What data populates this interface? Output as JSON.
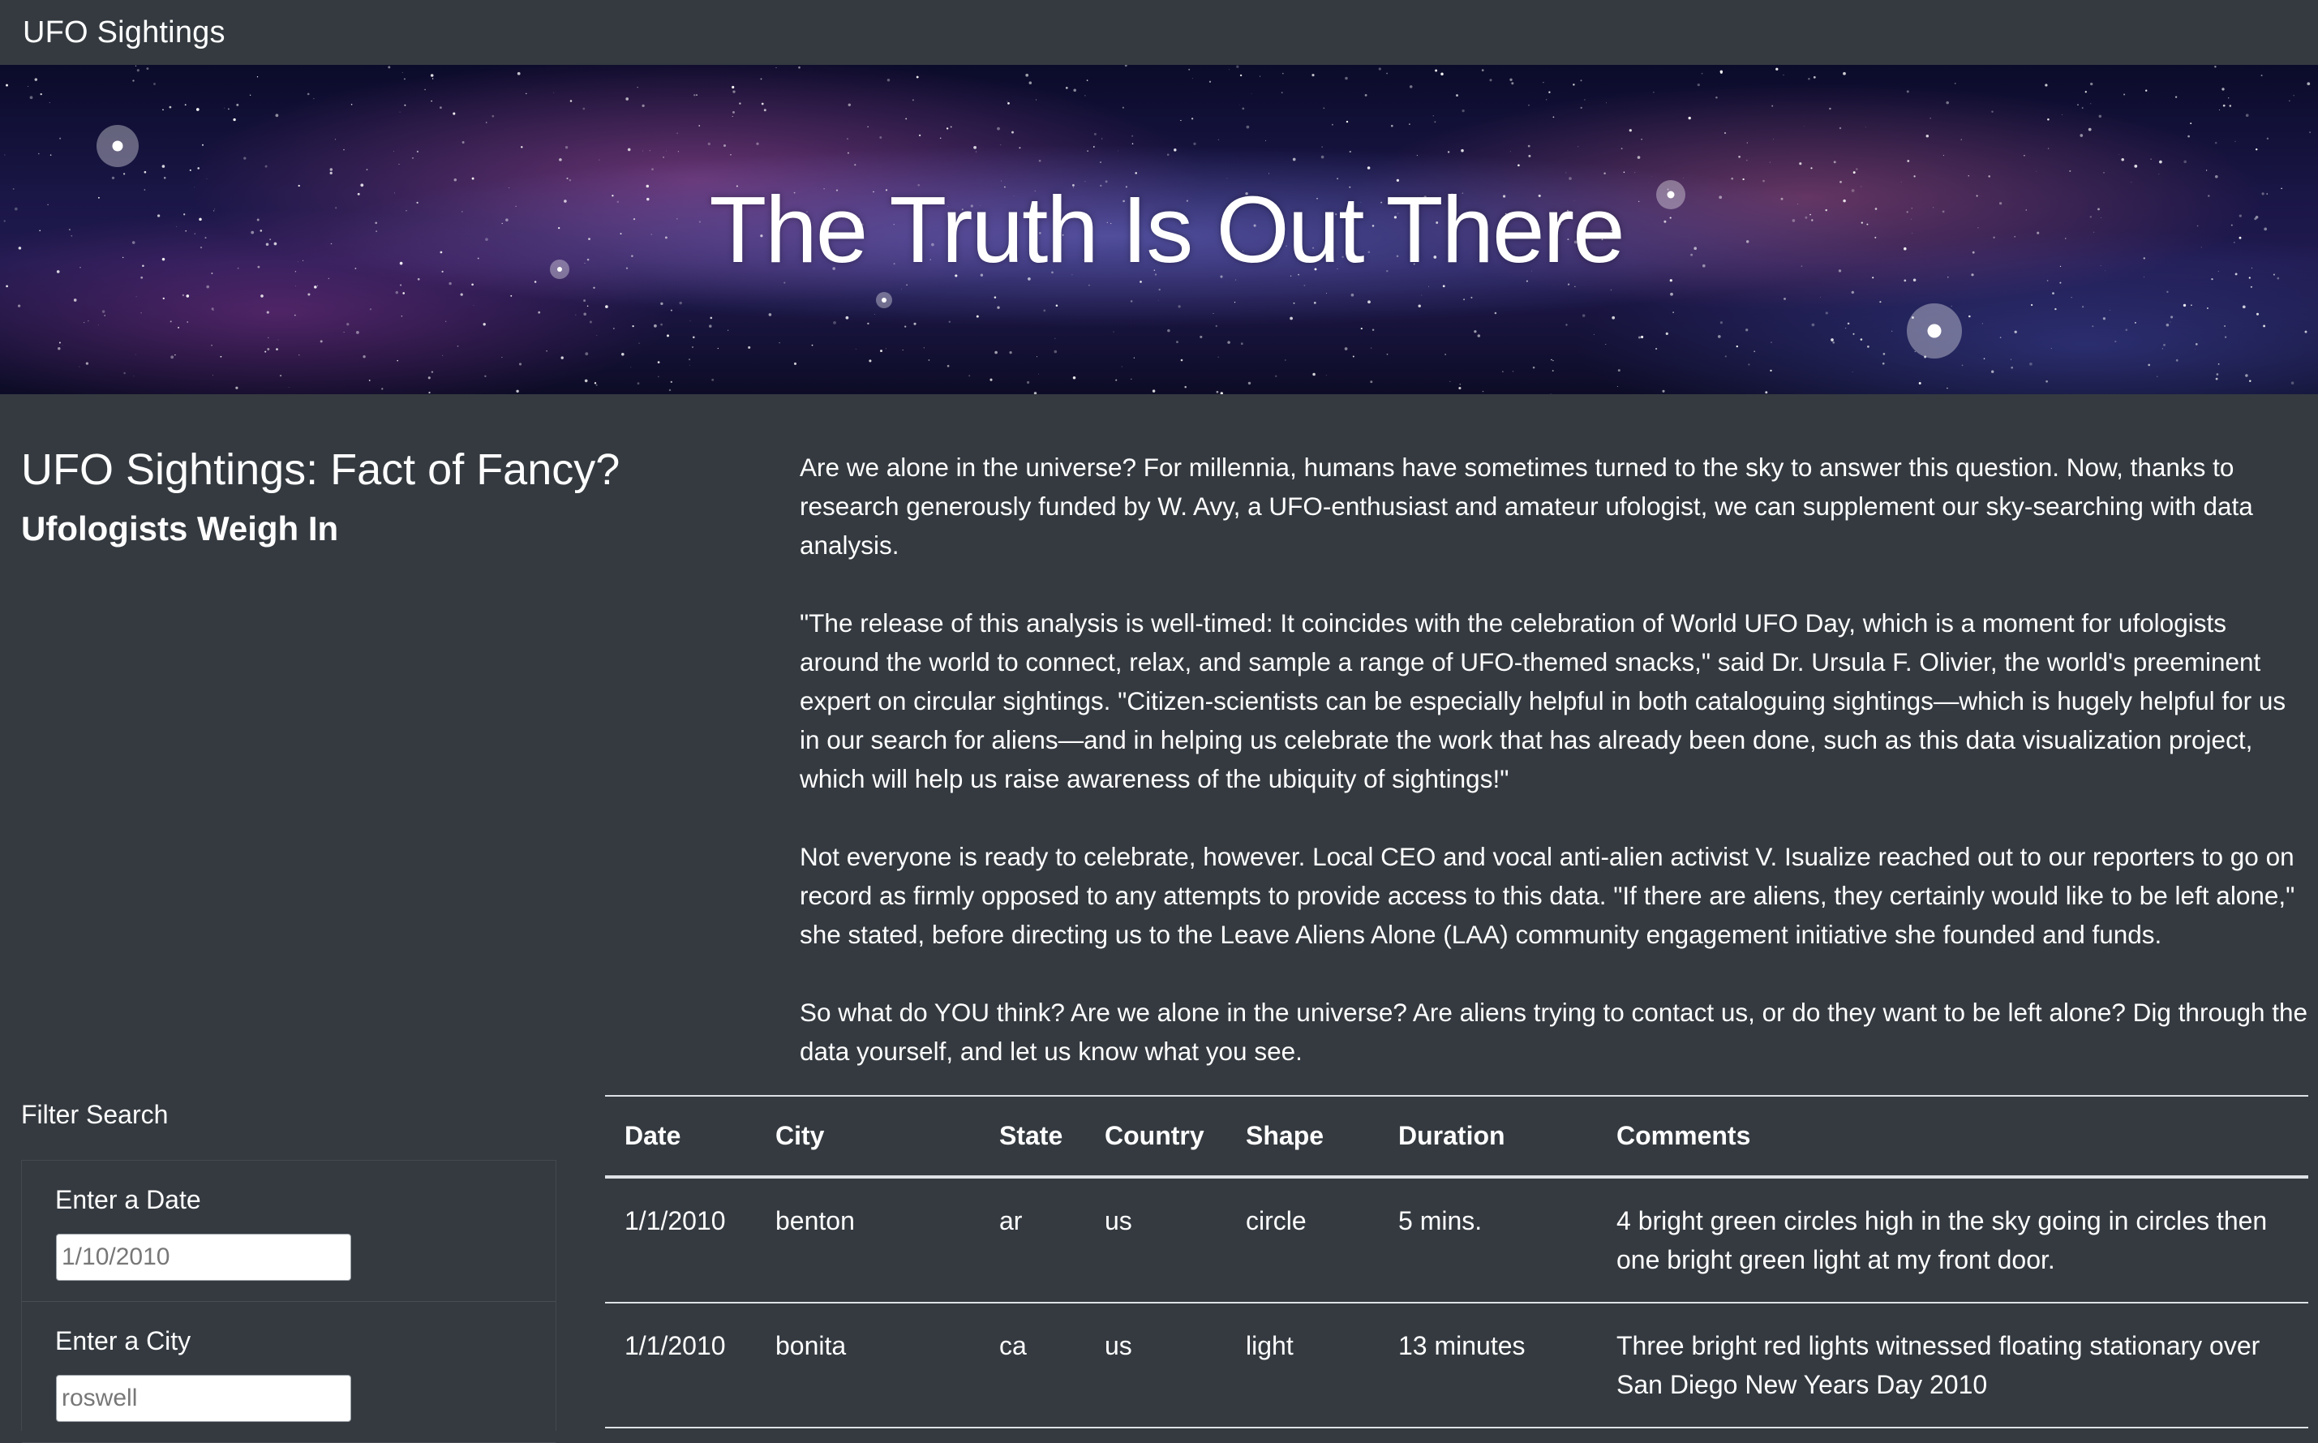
{
  "navbar": {
    "brand": "UFO Sightings"
  },
  "hero": {
    "title": "The Truth Is Out There"
  },
  "article": {
    "title": "UFO Sightings: Fact of Fancy?",
    "subtitle": "Ufologists Weigh In",
    "paragraphs": [
      "Are we alone in the universe? For millennia, humans have sometimes turned to the sky to answer this question. Now, thanks to research generously funded by W. Avy, a UFO-enthusiast and amateur ufologist, we can supplement our sky-searching with data analysis.",
      "\"The release of this analysis is well-timed: It coincides with the celebration of World UFO Day, which is a moment for ufologists around the world to connect, relax, and sample a range of UFO-themed snacks,\" said Dr. Ursula F. Olivier, the world's preeminent expert on circular sightings. \"Citizen-scientists can be especially helpful in both cataloguing sightings—which is hugely helpful for us in our search for aliens—and in helping us celebrate the work that has already been done, such as this data visualization project, which will help us raise awareness of the ubiquity of sightings!\"",
      "Not everyone is ready to celebrate, however. Local CEO and vocal anti-alien activist V. Isualize reached out to our reporters to go on record as firmly opposed to any attempts to provide access to this data. \"If there are aliens, they certainly would like to be left alone,\" she stated, before directing us to the Leave Aliens Alone (LAA) community engagement initiative she founded and funds.",
      "So what do YOU think? Are we alone in the universe? Are aliens trying to contact us, or do they want to be left alone? Dig through the data yourself, and let us know what you see."
    ]
  },
  "filter": {
    "title": "Filter Search",
    "date": {
      "label": "Enter a Date",
      "placeholder": "1/10/2010",
      "value": ""
    },
    "city": {
      "label": "Enter a City",
      "placeholder": "roswell",
      "value": ""
    }
  },
  "table": {
    "headers": [
      "Date",
      "City",
      "State",
      "Country",
      "Shape",
      "Duration",
      "Comments"
    ],
    "rows": [
      [
        "1/1/2010",
        "benton",
        "ar",
        "us",
        "circle",
        "5 mins.",
        "4 bright green circles high in the sky going in circles then one bright green light at my front door."
      ],
      [
        "1/1/2010",
        "bonita",
        "ca",
        "us",
        "light",
        "13 minutes",
        "Three bright red lights witnessed floating stationary over San Diego New Years Day 2010"
      ]
    ]
  },
  "colors": {
    "background": "#343a40",
    "text": "#ffffff",
    "table_border": "#dee2e6"
  },
  "icons": []
}
